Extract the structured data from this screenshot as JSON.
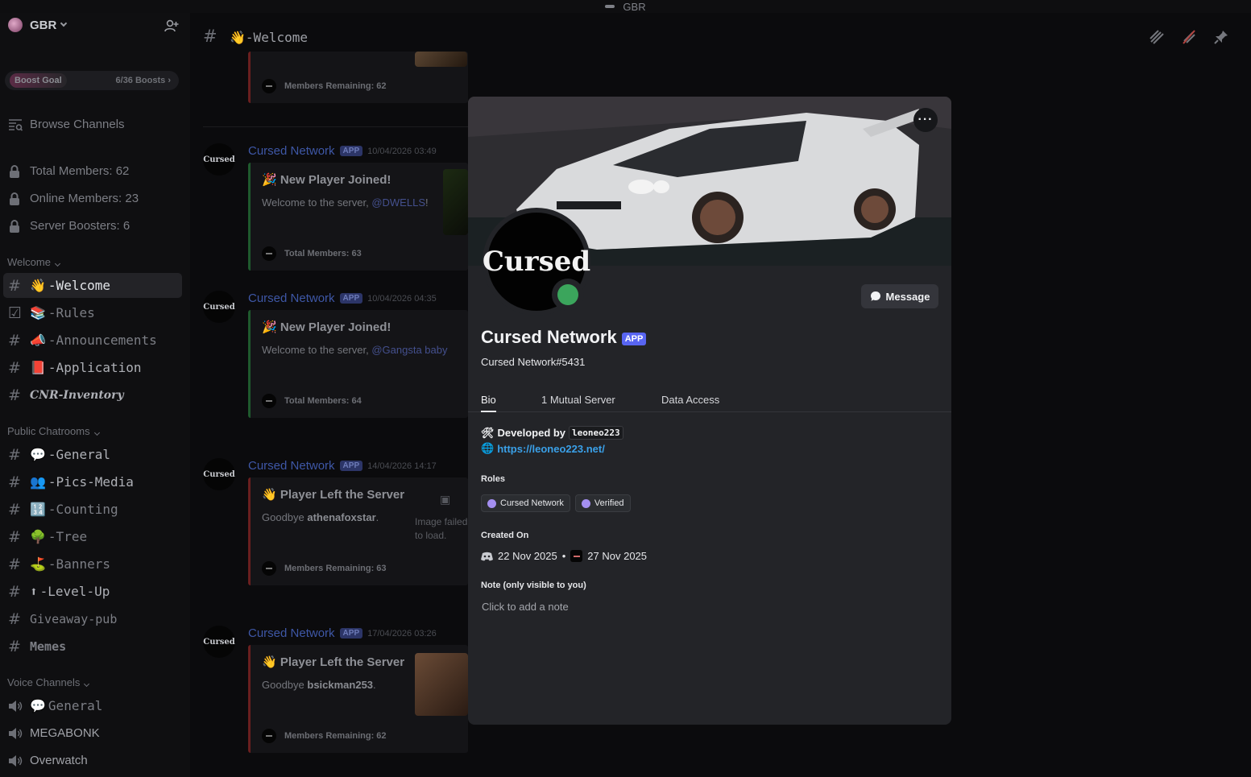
{
  "window": {
    "title": "GBR"
  },
  "guild": {
    "name": "GBR"
  },
  "boost": {
    "label": "Boost Goal",
    "count": "6/36 Boosts"
  },
  "browse": {
    "label": "Browse Channels"
  },
  "stats": [
    {
      "label": "Total Members: 62"
    },
    {
      "label": "Online Members: 23"
    },
    {
      "label": "Server Boosters: 6"
    }
  ],
  "categories": {
    "welcome": "Welcome",
    "public": "Public Chatrooms",
    "voice": "Voice Channels"
  },
  "channels": {
    "welcome": "-Welcome",
    "rules": "-Rules",
    "announcements": "-Announcements",
    "application": "-Application",
    "inventory": "CNR-Inventory",
    "general": "-General",
    "pics": "-Pics-Media",
    "counting": "-Counting",
    "tree": "-Tree",
    "banners": "-Banners",
    "levelup": "-Level-Up",
    "giveaway": "Giveaway-pub",
    "memes": "Memes",
    "voice_general": "General",
    "megabonk": "MEGABONK",
    "overwatch": "Overwatch"
  },
  "topbar": {
    "channel": "-Welcome"
  },
  "messages": [
    {
      "author": "Cursed Network",
      "tag": "APP",
      "time": "10/04/2026 03:49",
      "title": "New Player Joined!",
      "text": "Welcome to the server, ",
      "mention": "@DWELLS",
      "suffix": "!",
      "footer": "Total Members: 63"
    },
    {
      "author": "Cursed Network",
      "tag": "APP",
      "time": "10/04/2026 04:35",
      "title": "New Player Joined!",
      "text": "Welcome to the server, ",
      "mention": "@Gangsta baby",
      "suffix": "",
      "footer": "Total Members: 64"
    },
    {
      "author": "Cursed Network",
      "tag": "APP",
      "time": "14/04/2026 14:17",
      "title": "Player Left the Server",
      "text": "Goodbye ",
      "bold": "athenafoxstar",
      "suffix": ".",
      "footer": "Members Remaining: 63"
    },
    {
      "author": "Cursed Network",
      "tag": "APP",
      "time": "17/04/2026 03:26",
      "title": "Player Left the Server",
      "text": "Goodbye ",
      "bold": "bsickman253",
      "suffix": ".",
      "footer": "Members Remaining: 62"
    }
  ],
  "top_footer": "Members Remaining: 62",
  "image_failed": "Image failed to load.",
  "avatar_text": "Cursed",
  "profile": {
    "display_name": "Cursed Network",
    "tag": "APP",
    "username": "Cursed Network#5431",
    "message_button": "Message",
    "more_button": "···",
    "tabs": [
      "Bio",
      "1 Mutual Server",
      "Data Access"
    ],
    "bio_developed": "Developed by",
    "bio_dev_code": "leoneo223",
    "bio_link": "https://leoneo223.net/",
    "roles_label": "Roles",
    "roles": [
      "Cursed Network",
      "Verified"
    ],
    "created_label": "Created On",
    "created_discord": "22 Nov 2025",
    "created_server": "27 Nov 2025",
    "note_label": "Note (only visible to you)",
    "note_placeholder": "Click to add a note"
  },
  "colors": {
    "accent": "#5865f2",
    "online": "#3ba55c",
    "link": "#3aa0e8",
    "role": "#a48ff1"
  }
}
